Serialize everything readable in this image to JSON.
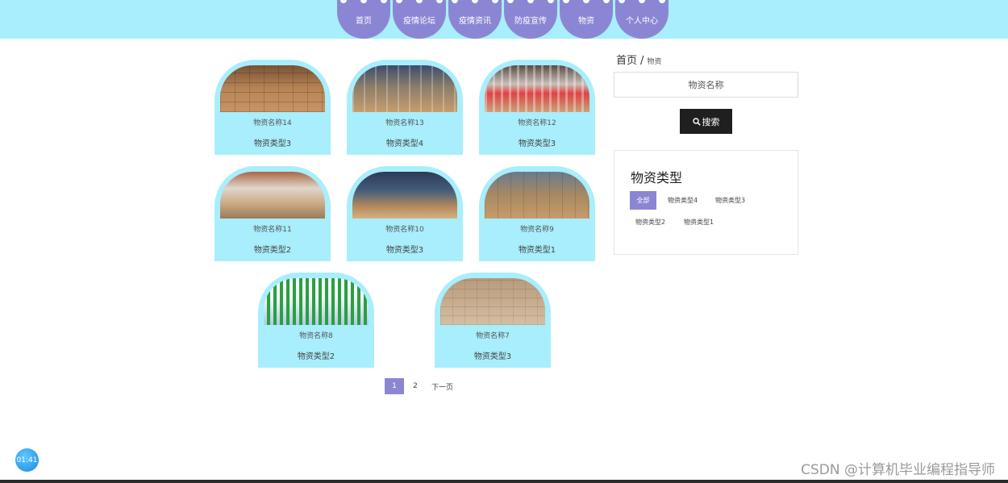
{
  "nav": {
    "items": [
      "首页",
      "疫情论坛",
      "疫情资讯",
      "防疫宣传",
      "物资",
      "个人中心"
    ]
  },
  "cards": [
    {
      "name": "物资名称14",
      "type": "物资类型3",
      "image": "tex-boxes"
    },
    {
      "name": "物资名称13",
      "type": "物资类型4",
      "image": "tex-warehouse"
    },
    {
      "name": "物资名称12",
      "type": "物资类型3",
      "image": "tex-stack"
    },
    {
      "name": "物资名称11",
      "type": "物资类型2",
      "image": "tex-hall"
    },
    {
      "name": "物资名称10",
      "type": "物资类型3",
      "image": "tex-people"
    },
    {
      "name": "物资名称9",
      "type": "物资类型1",
      "image": "tex-pallet"
    },
    {
      "name": "物资名称8",
      "type": "物资类型2",
      "image": "tex-bottles"
    },
    {
      "name": "物资名称7",
      "type": "物资类型3",
      "image": "tex-cartons"
    }
  ],
  "pagination": {
    "pages": [
      "1",
      "2"
    ],
    "current": "1",
    "next_label": "下一页"
  },
  "breadcrumb": {
    "home": "首页",
    "sep": "/",
    "current": "物资"
  },
  "search": {
    "placeholder": "物资名称",
    "button_label": "搜索"
  },
  "category": {
    "title": "物资类型",
    "tags": [
      "全部",
      "物资类型4",
      "物资类型3",
      "物资类型2",
      "物资类型1"
    ],
    "active": "全部"
  },
  "timer": {
    "text": "01:41"
  },
  "watermark": {
    "text": "CSDN @计算机毕业编程指导师"
  },
  "colors": {
    "header_bg": "#a8eefc",
    "accent": "#8b86d4",
    "button_dark": "#1f1f1f"
  }
}
